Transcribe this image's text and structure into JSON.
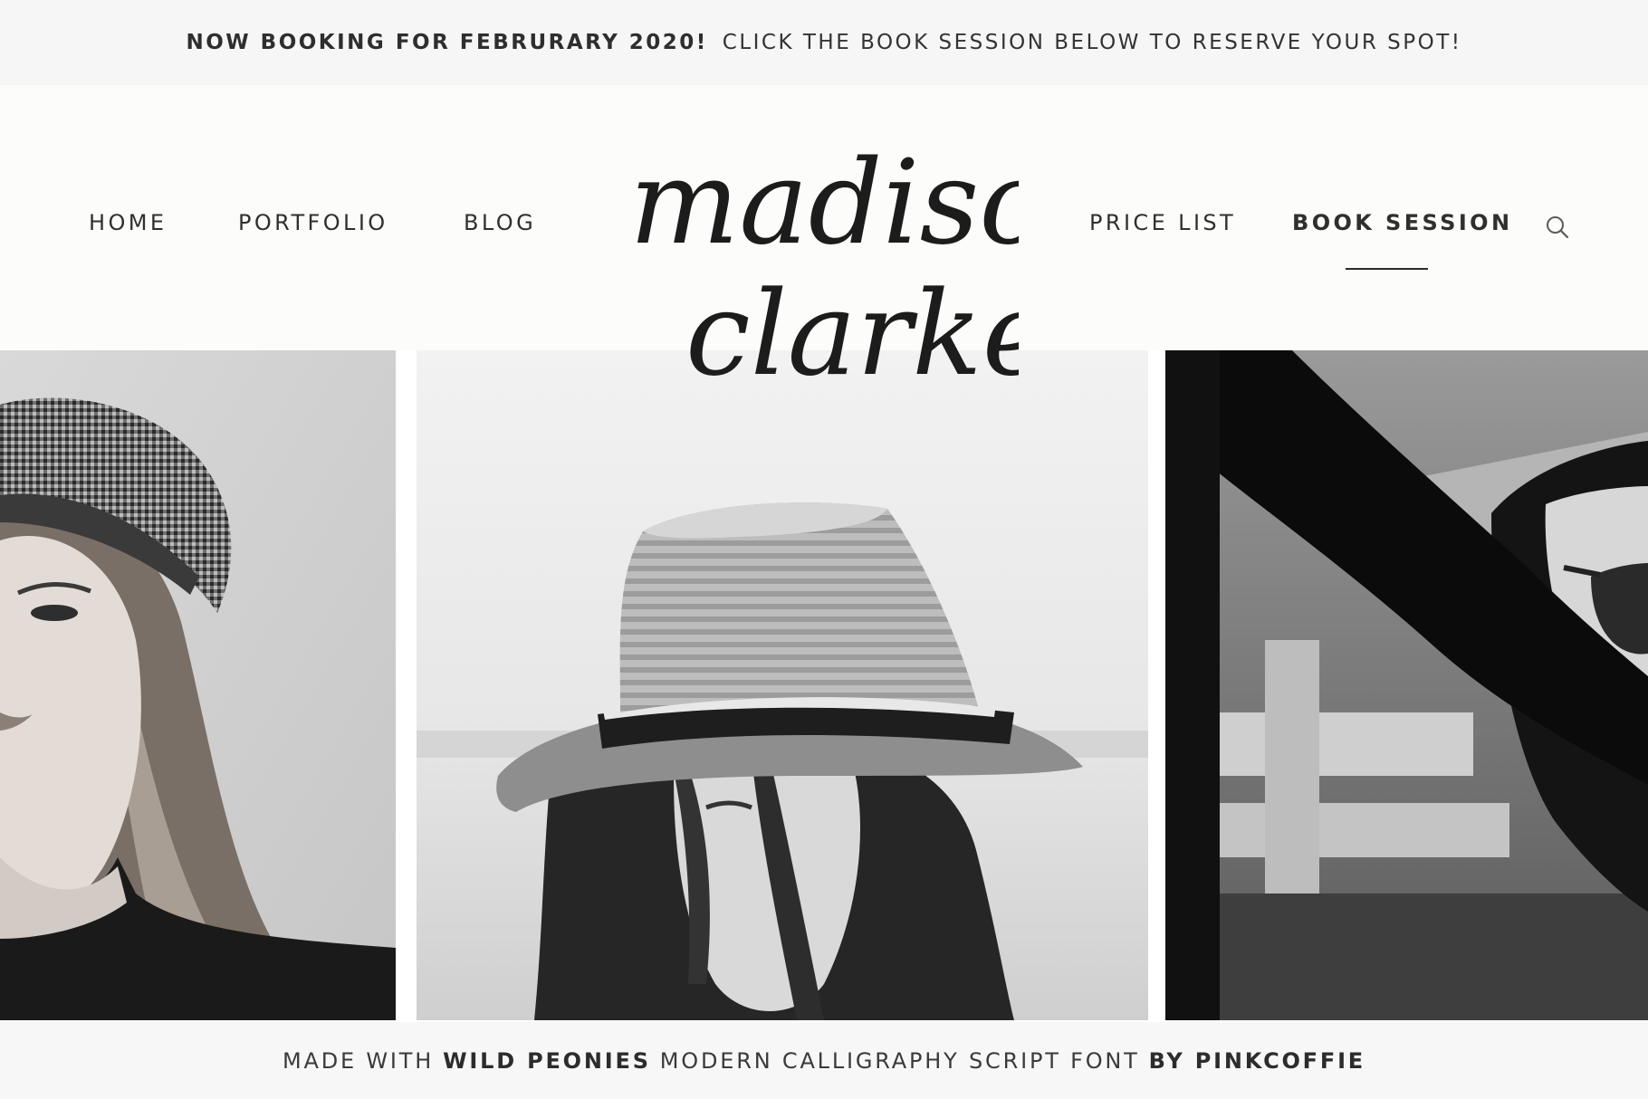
{
  "announcement": {
    "strong": "NOW BOOKING FOR FEBRURARY 2020!",
    "text": "CLICK THE BOOK SESSION BELOW TO RESERVE YOUR SPOT!"
  },
  "nav": {
    "home": "HOME",
    "portfolio": "PORTFOLIO",
    "blog": "BLOG",
    "price_list": "PRICE LIST",
    "book_session": "BOOK SESSION",
    "search_icon": "search-icon",
    "active_item": "BOOK SESSION"
  },
  "logo": {
    "line1": "madison",
    "line2": "clarke"
  },
  "photos": [
    {
      "name": "woman-in-plaid-cap"
    },
    {
      "name": "woman-in-straw-fedora"
    },
    {
      "name": "woman-with-sunglasses"
    }
  ],
  "footer": {
    "part1": "MADE WITH",
    "part2": "WILD PEONIES",
    "part3": "MODERN CALLIGRAPHY SCRIPT FONT",
    "part4": "BY PINKCOFFIE"
  },
  "colors": {
    "text": "#2b2b2b",
    "bar_background": "#f6f6f6",
    "header_background": "#fcfcfb"
  }
}
